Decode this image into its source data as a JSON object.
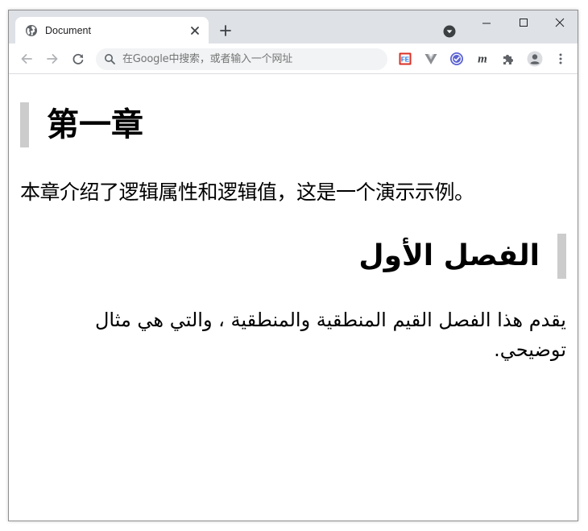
{
  "browser": {
    "tab": {
      "title": "Document"
    },
    "omnibox": {
      "placeholder": "在Google中搜索，或者输入一个网址"
    },
    "colors": {
      "tabstrip": "#dee1e6",
      "omnibox": "#f1f3f4",
      "heading_border": "#cccccc"
    },
    "icons": {
      "favicon": "globe-icon",
      "tab_close": "close-icon",
      "new_tab": "plus-icon",
      "back": "back-arrow-icon",
      "forward": "forward-arrow-icon",
      "reload": "reload-icon",
      "search": "search-icon",
      "extensions": [
        "feheader-extension-icon",
        "vue-devtools-icon",
        "check-extension-icon",
        "m-extension-icon",
        "puzzle-icon"
      ],
      "profile": "avatar-icon",
      "menu": "kebab-menu-icon"
    },
    "extension_labels": {
      "fe": "FE",
      "m": "m"
    }
  },
  "page": {
    "chapter_heading": "第一章",
    "chapter_text": "本章介绍了逻辑属性和逻辑值，这是一个演示示例。",
    "section_heading": "الفصل الأول",
    "section_text": "يقدم هذا الفصل القيم المنطقية والمنطقية ، والتي هي مثال توضيحي."
  }
}
